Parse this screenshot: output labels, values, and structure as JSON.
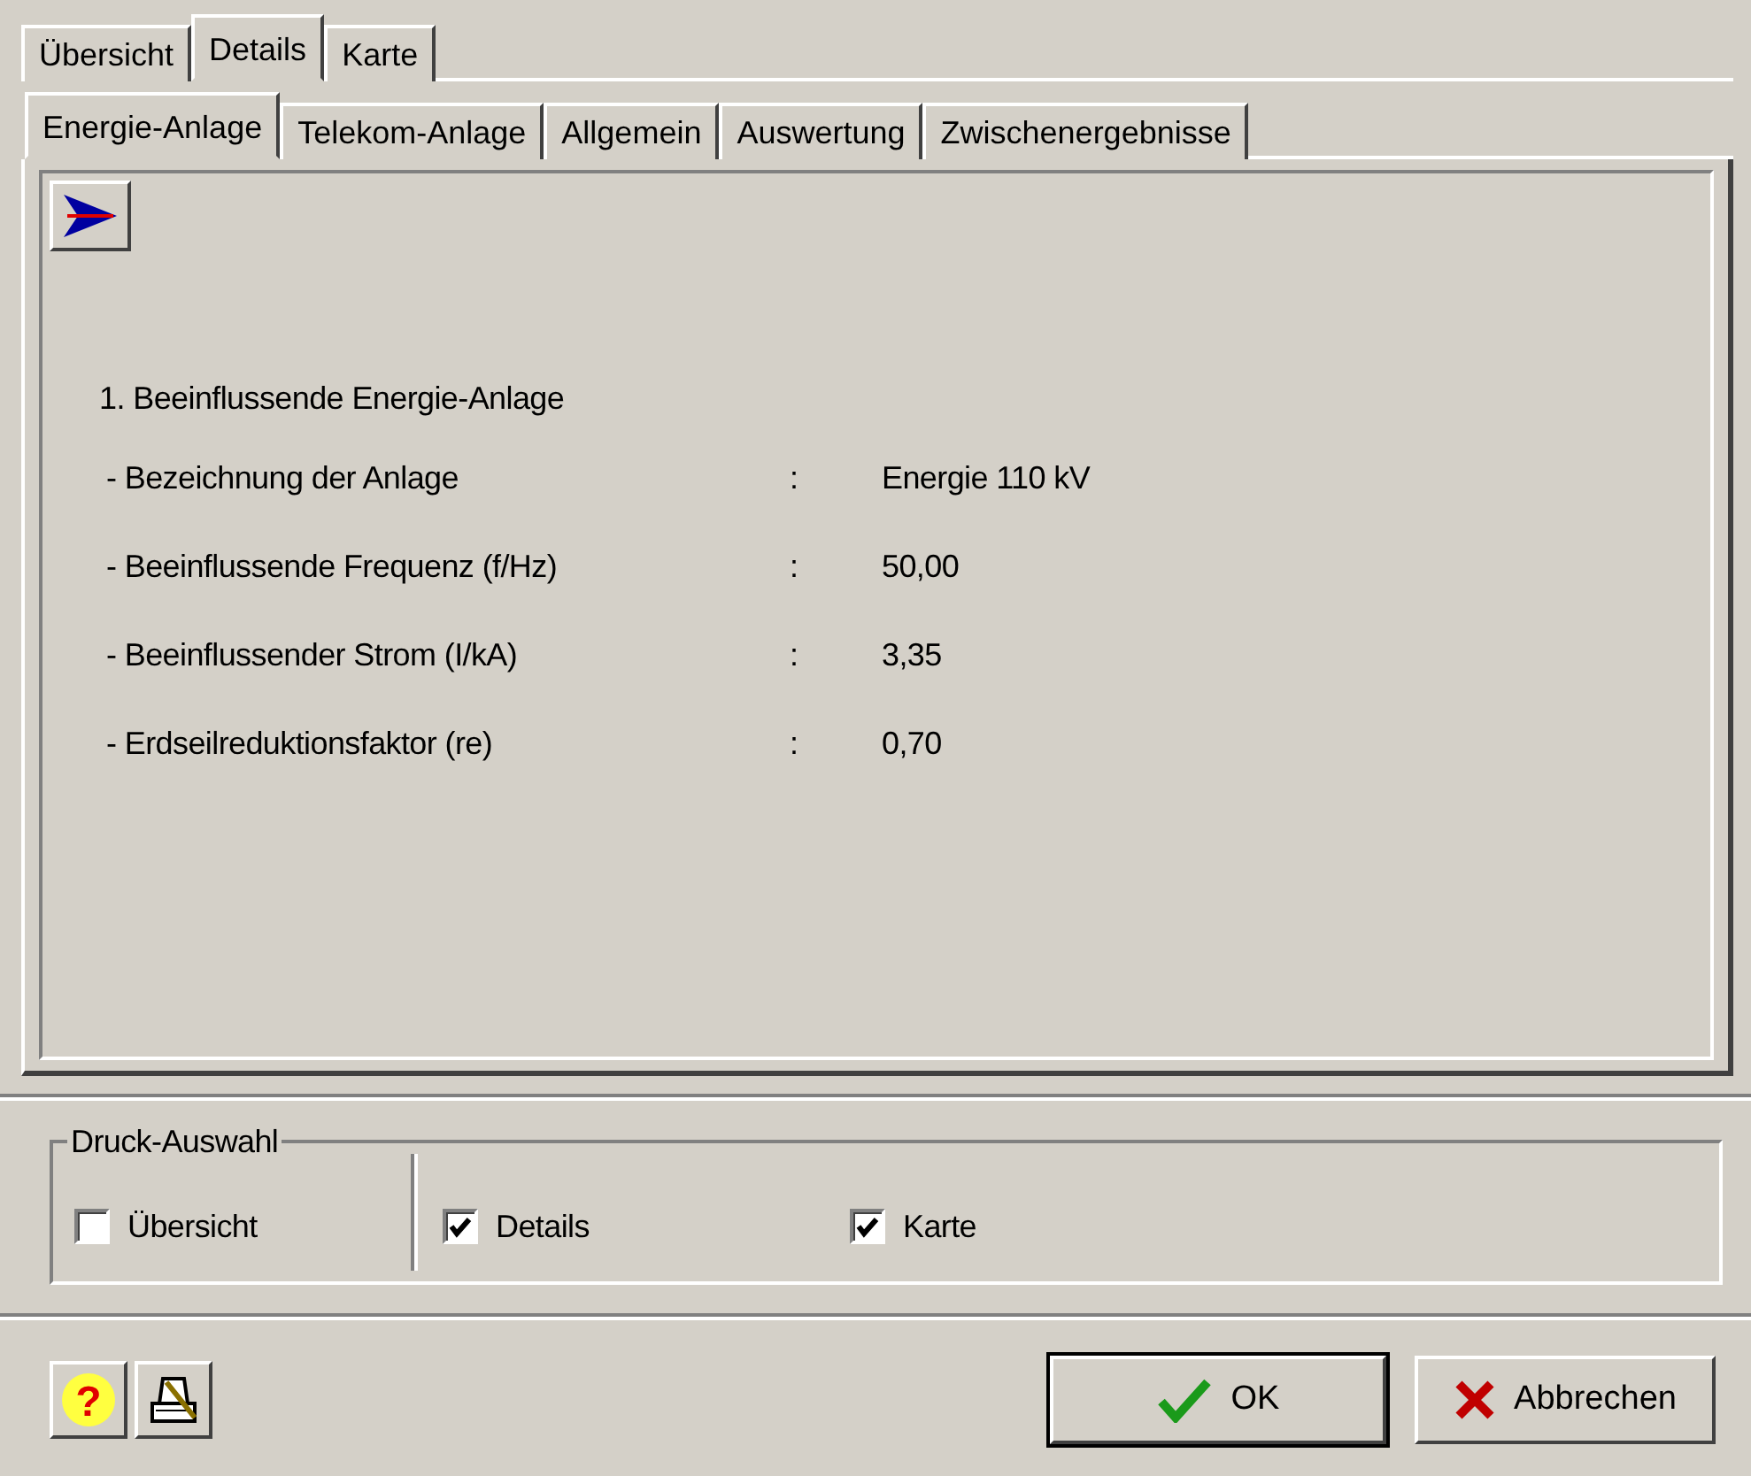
{
  "outer_tabs": [
    {
      "label": "Übersicht",
      "selected": false
    },
    {
      "label": "Details",
      "selected": true
    },
    {
      "label": "Karte",
      "selected": false
    }
  ],
  "inner_tabs": [
    {
      "label": "Energie-Anlage",
      "selected": true
    },
    {
      "label": "Telekom-Anlage",
      "selected": false
    },
    {
      "label": "Allgemein",
      "selected": false
    },
    {
      "label": "Auswertung",
      "selected": false
    },
    {
      "label": "Zwischenergebnisse",
      "selected": false
    }
  ],
  "section_title": "1. Beeinflussende Energie-Anlage",
  "rows": [
    {
      "label": "- Bezeichnung der Anlage",
      "separator": ":",
      "value": "Energie 110 kV"
    },
    {
      "label": "- Beeinflussende Frequenz (f/Hz)",
      "separator": ":",
      "value": "50,00"
    },
    {
      "label": "- Beeinflussender Strom (I/kA)",
      "separator": ":",
      "value": "3,35"
    },
    {
      "label": "- Erdseilreduktionsfaktor (re)",
      "separator": ":",
      "value": "0,70"
    }
  ],
  "print_selection": {
    "title": "Druck-Auswahl",
    "options": [
      {
        "label": "Übersicht",
        "checked": false
      },
      {
        "label": "Details",
        "checked": true
      },
      {
        "label": "Karte",
        "checked": true
      }
    ]
  },
  "help_button": {
    "glyph": "?"
  },
  "buttons": [
    {
      "kind": "ok",
      "label": "OK"
    },
    {
      "kind": "cancel",
      "label": "Abbrechen"
    }
  ]
}
